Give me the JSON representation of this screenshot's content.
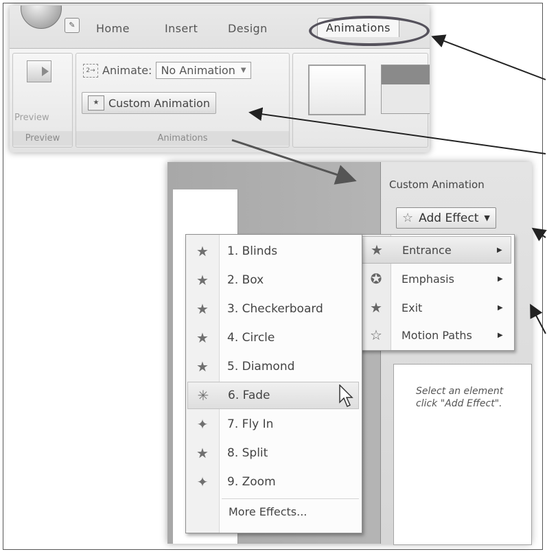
{
  "ribbon": {
    "tabs": [
      "Home",
      "Insert",
      "Design"
    ],
    "active_tab": "Animations",
    "preview_group": {
      "button_label": "Preview",
      "group_label": "Preview"
    },
    "animations_group": {
      "animate_label": "Animate:",
      "animate_value": "No Animation",
      "custom_animation_label": "Custom Animation",
      "group_label": "Animations"
    }
  },
  "task_pane": {
    "title": "Custom Animation",
    "add_effect_label": "Add Effect",
    "hint": "Select an element\nclick \"Add Effect\"."
  },
  "effect_submenu": {
    "items": [
      {
        "label": "Entrance",
        "icon": "entrance-star-icon"
      },
      {
        "label": "Emphasis",
        "icon": "emphasis-star-icon"
      },
      {
        "label": "Exit",
        "icon": "exit-star-icon"
      },
      {
        "label": "Motion Paths",
        "icon": "motion-path-star-icon"
      }
    ]
  },
  "entrance_menu": {
    "items": [
      "1. Blinds",
      "2. Box",
      "3. Checkerboard",
      "4. Circle",
      "5. Diamond",
      "6. Fade",
      "7. Fly In",
      "8. Split",
      "9. Zoom"
    ],
    "highlighted": "6. Fade",
    "more_label": "More Effects..."
  }
}
